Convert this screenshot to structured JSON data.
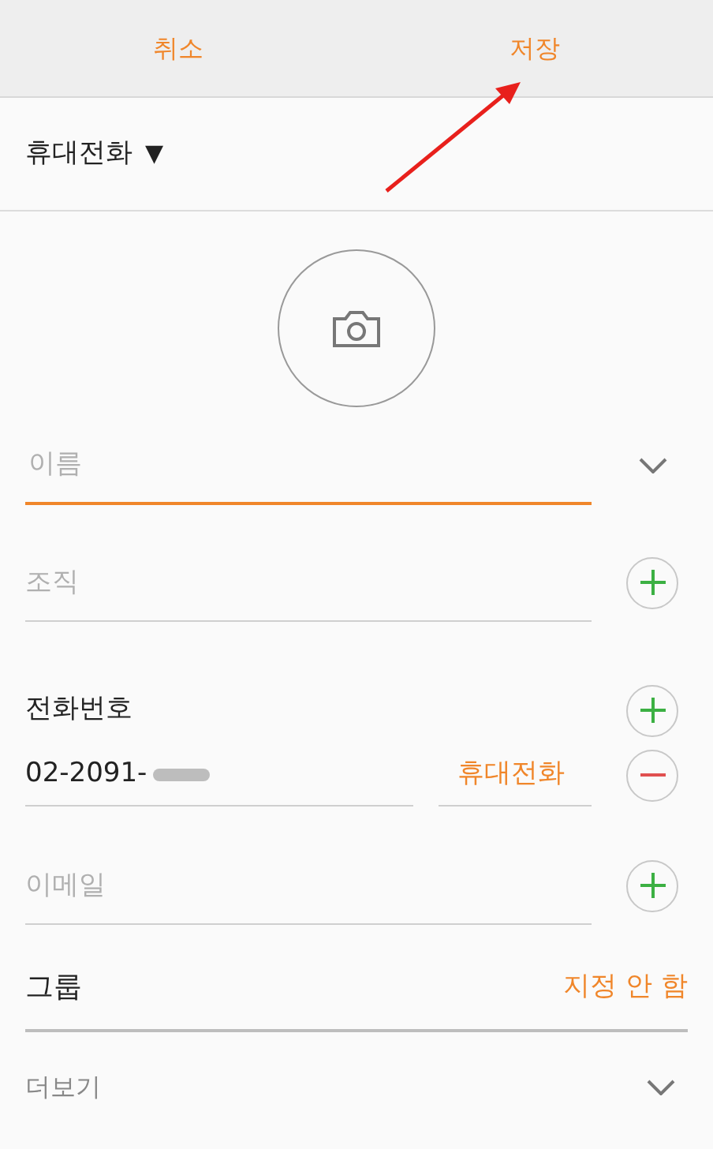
{
  "header": {
    "buttons": [
      {
        "label": "취소"
      },
      {
        "label": "저장"
      }
    ]
  },
  "account": {
    "label": "휴대전화",
    "dropdown_glyph": "▼"
  },
  "fields": [
    {
      "placeholder": "이름",
      "focused": true,
      "kind": "expand"
    },
    {
      "placeholder": "조직",
      "focused": false,
      "kind": "add"
    }
  ],
  "phone": {
    "label": "전화번호",
    "value": "02-2091-",
    "type": "휴대전화"
  },
  "email": {
    "placeholder": "이메일"
  },
  "group": {
    "label": "그룹",
    "value": "지정 안 함"
  },
  "more": {
    "label": "더보기"
  }
}
